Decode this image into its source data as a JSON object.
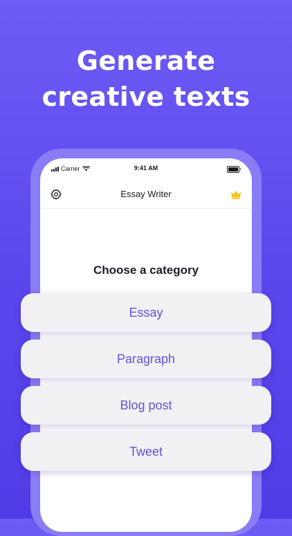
{
  "promo": {
    "headline_line1": "Generate",
    "headline_line2": "creative texts"
  },
  "status_bar": {
    "carrier": "Carrier",
    "time": "9:41 AM"
  },
  "nav": {
    "title": "Essay Writer",
    "left_icon": "gear-icon",
    "right_icon": "crown-icon"
  },
  "main": {
    "heading": "Choose a category",
    "categories": [
      {
        "label": "Essay"
      },
      {
        "label": "Paragraph"
      },
      {
        "label": "Blog post"
      },
      {
        "label": "Tweet"
      }
    ]
  },
  "colors": {
    "background": "#5a47ec",
    "accent_text": "#6452d8",
    "crown": "#f5c518"
  }
}
